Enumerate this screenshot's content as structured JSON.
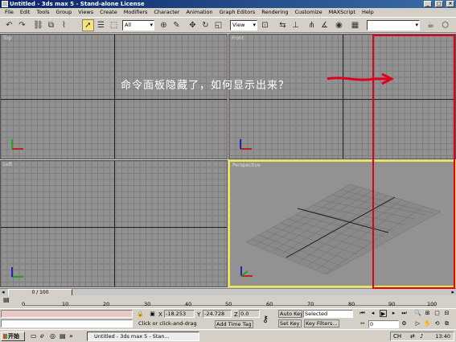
{
  "window": {
    "title": "Untitled - 3ds max 5 - Stand-alone License",
    "controls": [
      "_",
      "□",
      "×"
    ]
  },
  "menu": [
    "File",
    "Edit",
    "Tools",
    "Group",
    "Views",
    "Create",
    "Modifiers",
    "Character",
    "Animation",
    "Graph Editors",
    "Rendering",
    "Customize",
    "MAXScript",
    "Help"
  ],
  "toolbar": {
    "selection_filter": "All",
    "ref_coord": "View",
    "named_selection": ""
  },
  "viewports": {
    "top": "Top",
    "front": "Front",
    "left": "Left",
    "perspective": "Perspective"
  },
  "annotation": {
    "text": "命令面板隐藏了，如何显示出来？",
    "arrow_color": "#e0001e"
  },
  "timeslider": {
    "frame_label": "0 / 100"
  },
  "trackbar": {
    "ticks": [
      "0",
      "10",
      "20",
      "30",
      "40",
      "50",
      "60",
      "70",
      "80",
      "90",
      "100"
    ]
  },
  "status": {
    "x_label": "X",
    "x_value": "-18.253",
    "y_label": "Y",
    "y_value": "-24.728",
    "z_label": "Z",
    "z_value": "0.0",
    "prompt": "Click or click-and-drag",
    "add_time_tag": "Add Time Tag",
    "auto_key": "Auto Key",
    "set_key": "Set Key",
    "key_mode": "Selected",
    "key_filters": "Key Filters...",
    "frame": "0"
  },
  "taskbar": {
    "start": "开始",
    "app_button": "Untitled - 3ds max 5 - Stan...",
    "clock": "13:40"
  }
}
